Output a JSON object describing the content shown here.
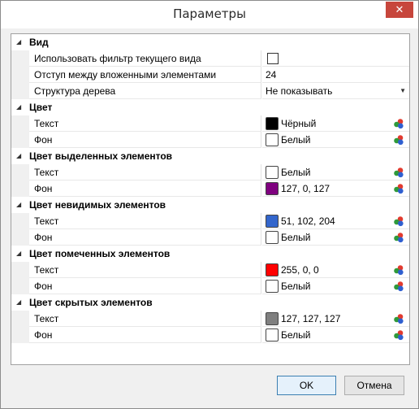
{
  "window": {
    "title": "Параметры",
    "close_label": "✕"
  },
  "categories": [
    {
      "label": "Вид",
      "rows": [
        {
          "name": "Использовать фильтр текущего вида",
          "type": "checkbox",
          "checked": false
        },
        {
          "name": "Отступ между вложенными элементами",
          "type": "text",
          "value": "24"
        },
        {
          "name": "Структура дерева",
          "type": "dropdown",
          "value": "Не показывать"
        }
      ]
    },
    {
      "label": "Цвет",
      "rows": [
        {
          "name": "Текст",
          "type": "color",
          "value": "Чёрный",
          "color": "#000000"
        },
        {
          "name": "Фон",
          "type": "color",
          "value": "Белый",
          "color": "#ffffff"
        }
      ]
    },
    {
      "label": "Цвет выделенных элементов",
      "rows": [
        {
          "name": "Текст",
          "type": "color",
          "value": "Белый",
          "color": "#ffffff"
        },
        {
          "name": "Фон",
          "type": "color",
          "value": "127, 0, 127",
          "color": "#7f007f"
        }
      ]
    },
    {
      "label": "Цвет невидимых элементов",
      "rows": [
        {
          "name": "Текст",
          "type": "color",
          "value": "51, 102, 204",
          "color": "#3366cc"
        },
        {
          "name": "Фон",
          "type": "color",
          "value": "Белый",
          "color": "#ffffff"
        }
      ]
    },
    {
      "label": "Цвет помеченных элементов",
      "rows": [
        {
          "name": "Текст",
          "type": "color",
          "value": "255, 0, 0",
          "color": "#ff0000"
        },
        {
          "name": "Фон",
          "type": "color",
          "value": "Белый",
          "color": "#ffffff"
        }
      ]
    },
    {
      "label": "Цвет скрытых элементов",
      "rows": [
        {
          "name": "Текст",
          "type": "color",
          "value": "127, 127, 127",
          "color": "#7f7f7f"
        },
        {
          "name": "Фон",
          "type": "color",
          "value": "Белый",
          "color": "#ffffff"
        }
      ]
    }
  ],
  "buttons": {
    "ok_label": "OK",
    "cancel_label": "Отмена"
  },
  "icons": {
    "category_toggle": "expanded-triangle-icon",
    "color_picker": "color-palette-icon",
    "dropdown": "dropdown-arrow-icon"
  }
}
